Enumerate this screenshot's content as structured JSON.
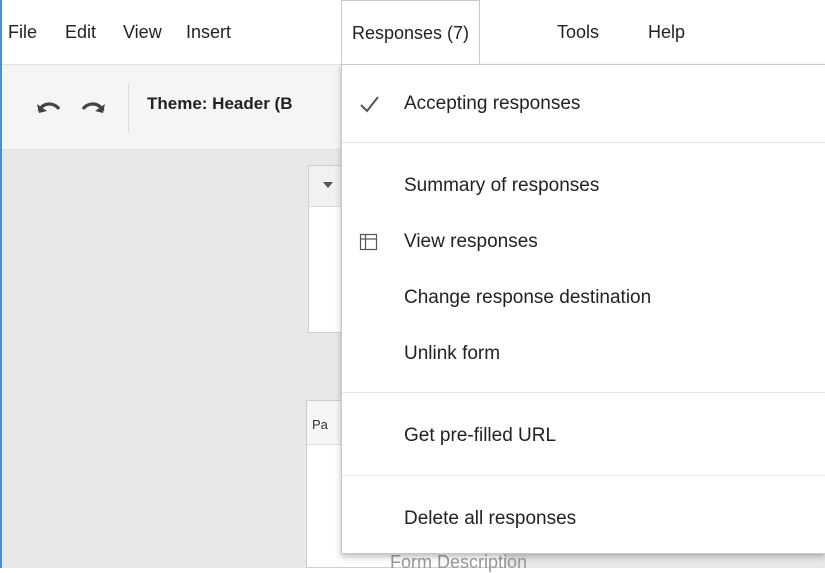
{
  "menubar": {
    "items": [
      {
        "label": "File"
      },
      {
        "label": "Edit"
      },
      {
        "label": "View"
      },
      {
        "label": "Insert"
      },
      {
        "label": "Responses (7)"
      },
      {
        "label": "Tools"
      },
      {
        "label": "Help"
      }
    ]
  },
  "toolbar": {
    "undo_icon": "undo-icon",
    "redo_icon": "redo-icon",
    "theme_label": "Theme: Header (B"
  },
  "canvas": {
    "card2_header": "Pa",
    "form_description": "Form Description"
  },
  "responses_menu": {
    "accepting": {
      "label": "Accepting responses",
      "checked": true,
      "icon": "check-icon"
    },
    "summary": {
      "label": "Summary of responses"
    },
    "view": {
      "label": "View responses",
      "icon": "table-icon"
    },
    "change_destination": {
      "label": "Change response destination"
    },
    "unlink": {
      "label": "Unlink form"
    },
    "prefilled": {
      "label": "Get pre-filled URL"
    },
    "delete_all": {
      "label": "Delete all responses"
    }
  },
  "colors": {
    "frame_accent": "#4a90d9",
    "toolbar_bg": "#f5f5f5",
    "canvas_bg": "#e8e8e8"
  }
}
